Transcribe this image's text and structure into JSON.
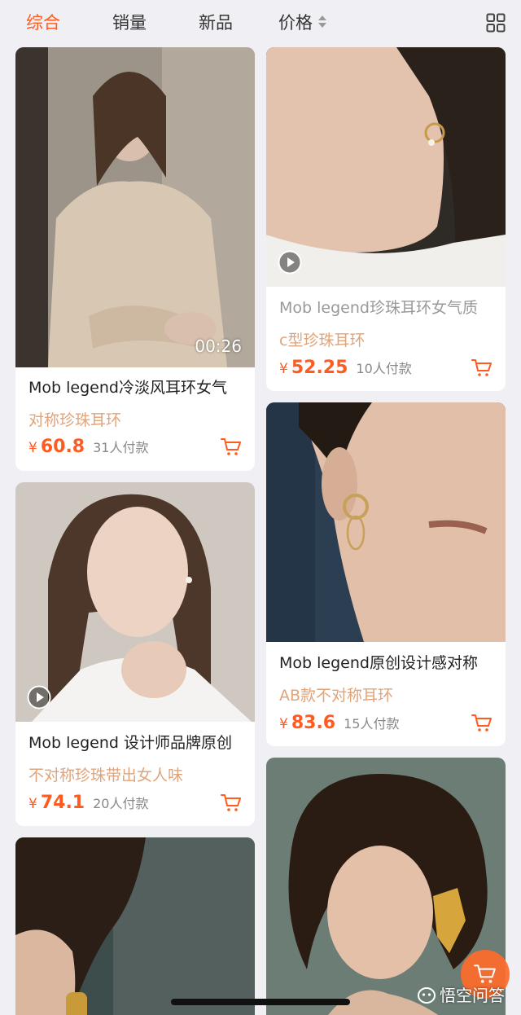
{
  "sort_bar": {
    "tabs": [
      "综合",
      "销量",
      "新品",
      "价格"
    ],
    "active_tab": "综合",
    "accent_color": "#ff5a1f"
  },
  "icons": {
    "layout_toggle": "grid-layout-icon",
    "cart": "cart-icon",
    "play": "play-icon",
    "floating_cart": "cart-icon"
  },
  "products": [
    {
      "title": "Mob legend冷淡风耳环女气",
      "subtitle": "对称珍珠耳环",
      "currency": "¥",
      "price": "60.8",
      "sales": "31人付款",
      "video_duration": "00:26"
    },
    {
      "title": "Mob legend珍珠耳环女气质",
      "subtitle": "c型珍珠耳环",
      "currency": "¥",
      "price": "52.25",
      "sales": "10人付款"
    },
    {
      "title": "Mob legend 设计师品牌原创",
      "subtitle": "不对称珍珠带出女人味",
      "currency": "¥",
      "price": "74.1",
      "sales": "20人付款"
    },
    {
      "title": "Mob legend原创设计感对称",
      "subtitle": "AB款不对称耳环",
      "currency": "¥",
      "price": "83.6",
      "sales": "15人付款"
    }
  ],
  "watermark": {
    "text": "悟空问答"
  }
}
